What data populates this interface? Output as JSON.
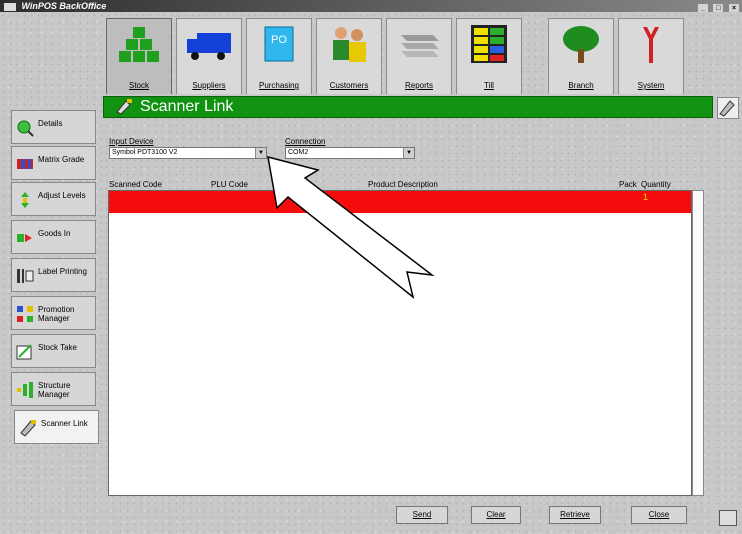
{
  "window": {
    "title": "WinPOS BackOffice",
    "controls": [
      "_",
      "□",
      "×"
    ]
  },
  "toolbar": [
    {
      "label": "Stock",
      "icon": "stock-blocks-icon",
      "active": true
    },
    {
      "label": "Suppliers",
      "icon": "truck-icon"
    },
    {
      "label": "Purchasing",
      "icon": "purchase-order-icon"
    },
    {
      "label": "Customers",
      "icon": "people-icon"
    },
    {
      "label": "Reports",
      "icon": "reports-stack-icon"
    },
    {
      "label": "Till",
      "icon": "till-keypad-icon"
    },
    {
      "label": "Branch",
      "icon": "tree-icon"
    },
    {
      "label": "System",
      "icon": "tools-icon"
    }
  ],
  "sidebar": [
    {
      "label": "Details",
      "icon": "magnifier-icon"
    },
    {
      "label": "Matrix Grade",
      "icon": "matrix-icon"
    },
    {
      "label": "Adjust Levels",
      "icon": "adjust-arrows-icon"
    },
    {
      "label": "Goods In",
      "icon": "goods-in-arrow-icon"
    },
    {
      "label": "Label Printing",
      "icon": "label-printer-icon"
    },
    {
      "label": "Promotion Manager",
      "icon": "promotion-icon"
    },
    {
      "label": "Stock Take",
      "icon": "stock-take-pencil-icon"
    },
    {
      "label": "Structure Manager",
      "icon": "structure-icon"
    },
    {
      "label": "Scanner Link",
      "icon": "scanner-icon",
      "active": true
    }
  ],
  "panel": {
    "title": "Scanner Link",
    "input_device_label": "Input Device",
    "input_device_value": "Symbol PDT3100 V2",
    "connection_label": "Connection",
    "connection_value": "COM2",
    "columns": {
      "scanned_code": "Scanned Code",
      "plu_code": "PLU Code",
      "desc": "Product Description",
      "pack": "Pack",
      "quantity": "Quantity"
    },
    "rows": [
      {
        "quantity": "1"
      }
    ]
  },
  "buttons": {
    "send": "Send",
    "clear": "Clear",
    "retrieve": "Retrieve",
    "close": "Close"
  },
  "colors": {
    "header_green": "#119311",
    "row_red": "#f40c0c",
    "qty_yellow": "#ffd800"
  }
}
